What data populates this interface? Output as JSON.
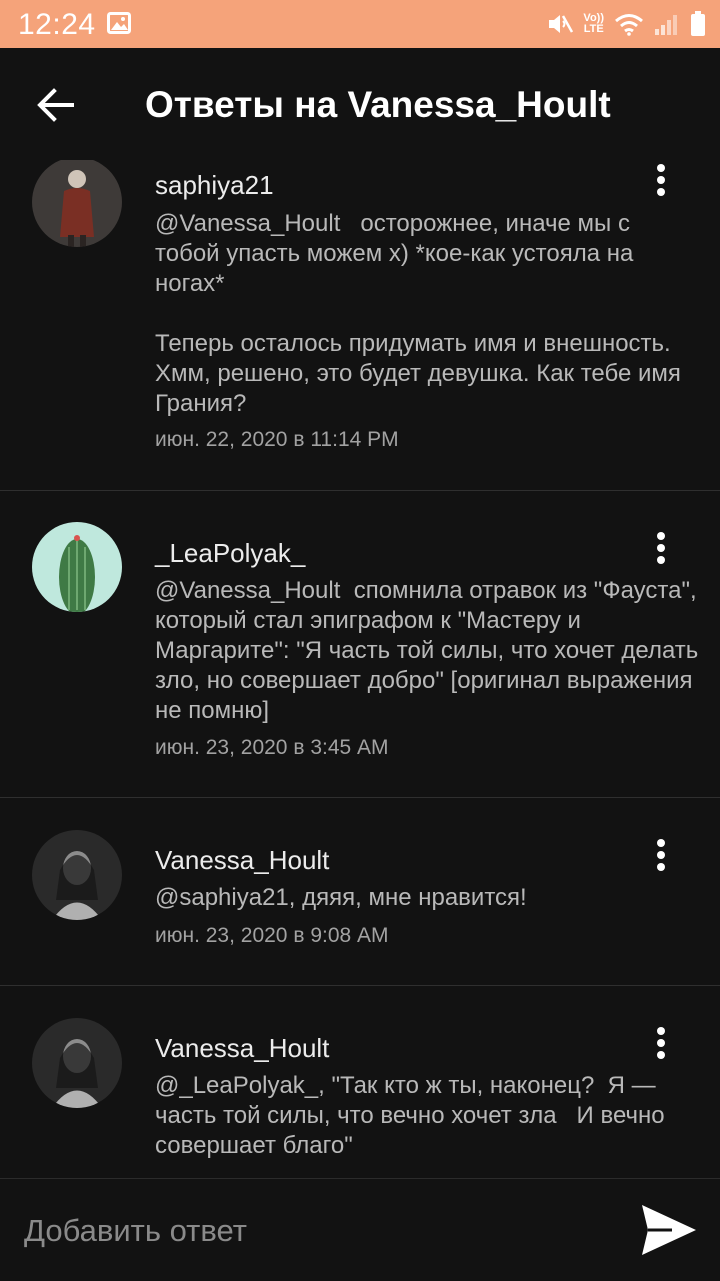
{
  "status_bar": {
    "time": "12:24",
    "indicators": [
      "image-icon",
      "mute-icon",
      "volte-icon",
      "wifi-icon",
      "signal-icon",
      "battery-icon"
    ],
    "volte_top": "Vo))",
    "volte_bottom": "LTE"
  },
  "app_bar": {
    "title": "Ответы на Vanessa_Hoult",
    "back_icon": "arrow-left-icon"
  },
  "comments": [
    {
      "username": "saphiya21",
      "text": "@Vanessa_Hoult   осторожнее, иначе мы с тобой упасть можем х) *кое-как устояла на ногах*\n\nТеперь осталось придумать имя и внешность. Хмм, решено, это будет девушка. Как тебе имя Грания?",
      "date": "июн. 22, 2020 в 11:14 PM"
    },
    {
      "username": "_LeaPolyak_",
      "text": "@Vanessa_Hoult  спомнила отравок из \"Фауста\", который стал эпиграфом к \"Мастеру и Маргарите\": \"Я часть той силы, что хочет делать зло, но совершает добро\" [оригинал выражения не помню]",
      "date": "июн. 23, 2020 в 3:45 AM"
    },
    {
      "username": "Vanessa_Hoult",
      "text": "@saphiya21, дяяя, мне нравится!",
      "date": "июн. 23, 2020 в 9:08 AM"
    },
    {
      "username": "Vanessa_Hoult",
      "text": "@_LeaPolyak_, \"Так кто ж ты, наконец?  Я — часть той силы, что вечно хочет зла   И вечно совершает благо\"",
      "date": ""
    }
  ],
  "composer": {
    "placeholder": "Добавить ответ",
    "send_icon": "send-icon"
  },
  "colors": {
    "status_bar": "#F5A37A",
    "background": "#121212",
    "divider": "#2f2f2f",
    "text_primary": "#ececec",
    "text_secondary": "#b9b9b9"
  }
}
